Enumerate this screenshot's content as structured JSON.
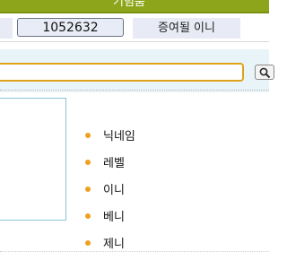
{
  "header": {
    "title": "기념품"
  },
  "info": {
    "id_value": "1052632",
    "gift_label": "증여될 이니"
  },
  "search": {
    "value": "",
    "icon": "search-icon"
  },
  "attributes": [
    {
      "label": "닉네임"
    },
    {
      "label": "레벨"
    },
    {
      "label": "이니"
    },
    {
      "label": "베니"
    },
    {
      "label": "제니"
    }
  ],
  "colors": {
    "header_bar": "#8ca51a",
    "search_border": "#e0a21b",
    "bullet": "#f0a020",
    "profile_border": "#8cc3d9"
  }
}
